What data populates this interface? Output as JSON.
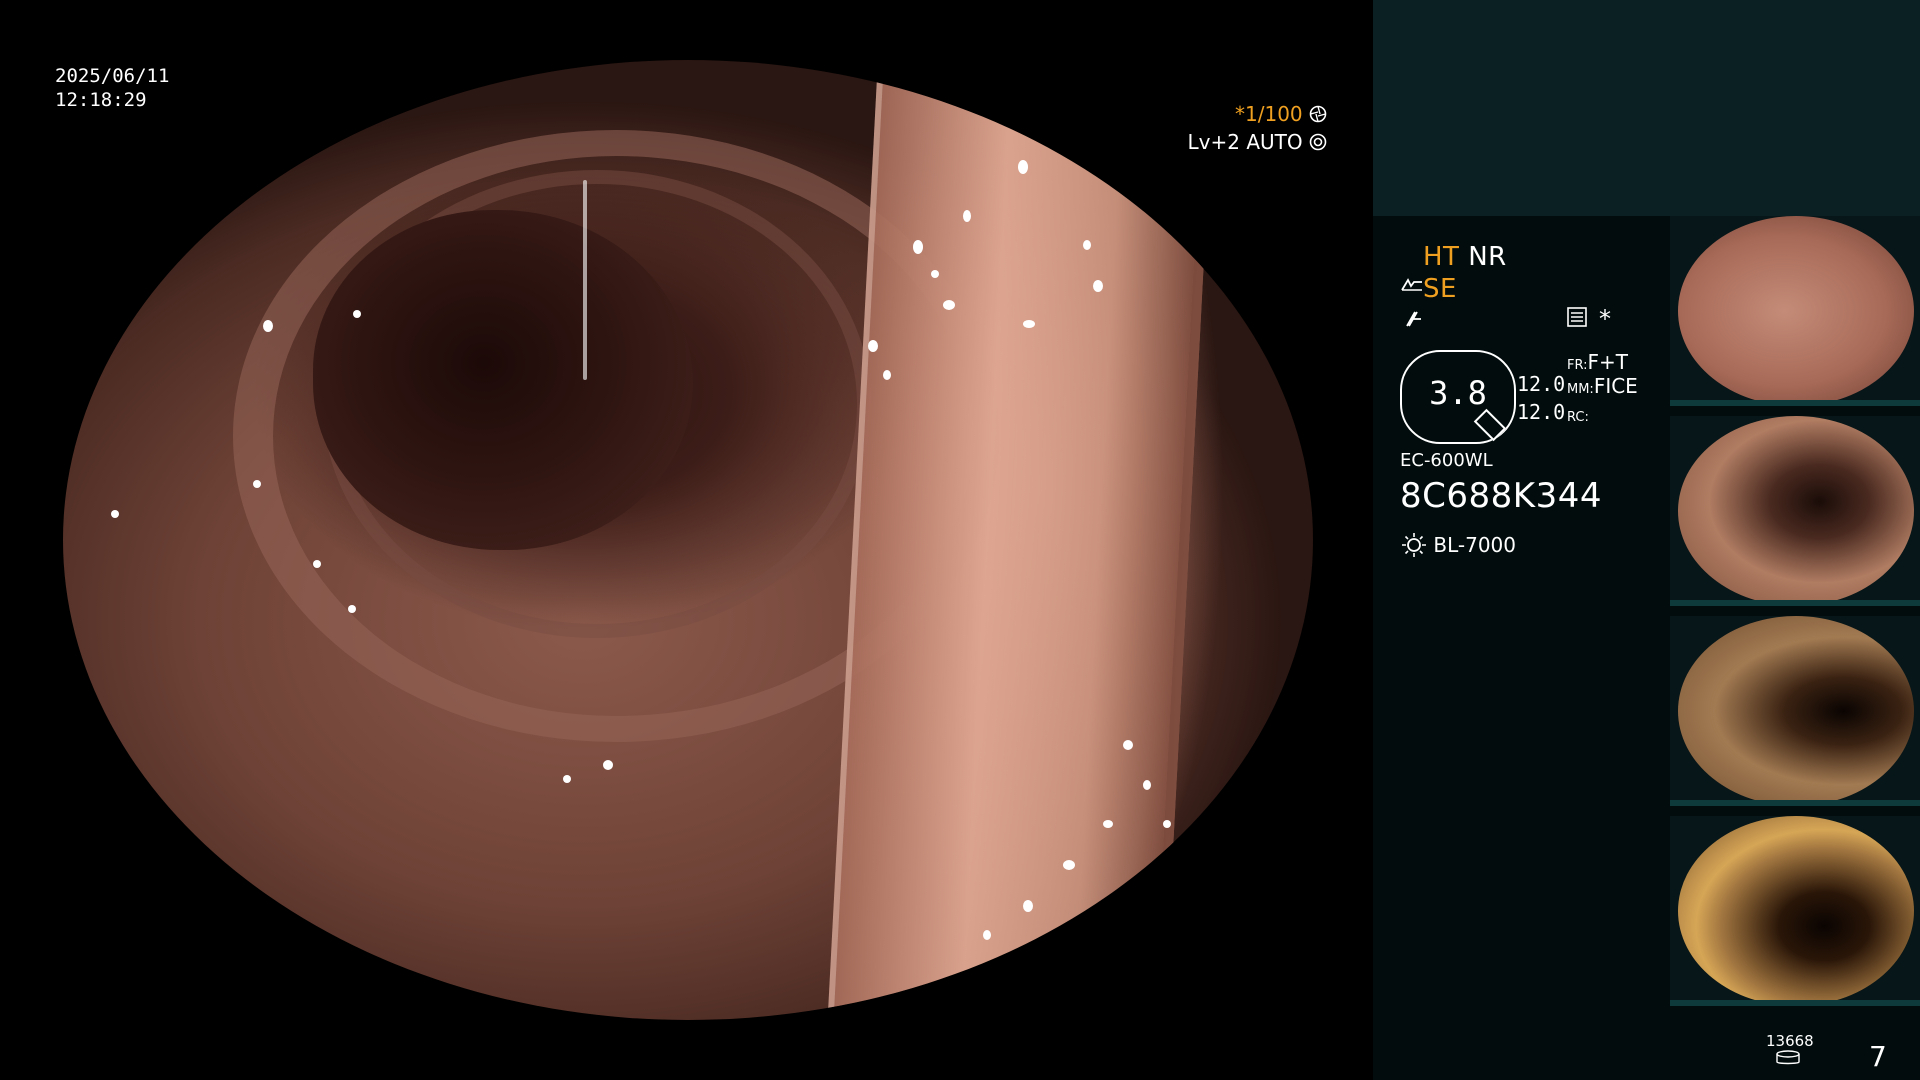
{
  "overlay": {
    "date": "2025/06/11",
    "time": "12:18:29",
    "shutter_prefix": "*",
    "shutter": "1/100",
    "shutter_icon": "aperture-icon",
    "level": "Lv+2",
    "mode": "AUTO",
    "mode_icon": "auto-iris-icon"
  },
  "panel": {
    "ht": "HT",
    "nr": "NR",
    "se": "SE",
    "se_icon": "structure-enhance-icon",
    "edge_icon": "edge-icon",
    "menu_icon": "settings-list-icon",
    "star": "*",
    "magnification": "3.8",
    "fr_label": "FR:",
    "fr_value": "F+T",
    "mm_label": "MM:",
    "mm_value": "FICE",
    "rc_label": "RC:",
    "rc_value": "",
    "value_1": "12.0",
    "value_2": "12.0",
    "scope_model": "EC-600WL",
    "scope_serial": "8C688K344",
    "light_icon": "light-source-icon",
    "light_source": "BL-7000",
    "storage_count": "13668",
    "storage_icon": "storage-disk-icon",
    "capture_count": "7"
  },
  "thumbnails": [
    {
      "name": "thumbnail-1",
      "tone": "#b87a6a"
    },
    {
      "name": "thumbnail-2",
      "tone": "#a46c52"
    },
    {
      "name": "thumbnail-3",
      "tone": "#8c5e3e"
    },
    {
      "name": "thumbnail-4",
      "tone": "#946434"
    }
  ]
}
